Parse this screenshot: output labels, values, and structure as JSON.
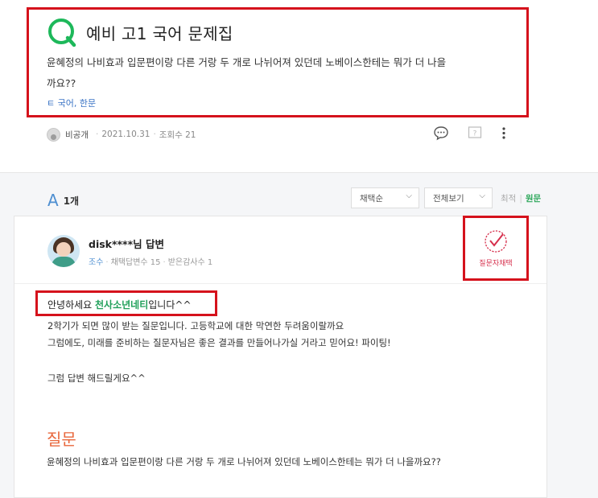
{
  "question": {
    "title": "예비 고1 국어 문제집",
    "body_line1": "윤혜정의 나비효과 입문편이랑 다른 거랑 두 개로 나뉘어져 있던데 노베이스한테는 뭐가 더 나을",
    "body_line2": "까요??",
    "tags": "ㅌ 국어, 한문",
    "author": "비공개",
    "date": "2021.10.31",
    "views": "조회수 21"
  },
  "answers": {
    "count_label": "1개",
    "sort_select": "채택순",
    "filter_select": "전체보기",
    "toggle_latest": "최적",
    "toggle_original": "원문"
  },
  "answer": {
    "name": "disk****님",
    "name_suffix": "답변",
    "grade": "조수",
    "adopted": "채택답변수 15",
    "thanks": "받은감사수 1",
    "adopt_label": "질문자채택",
    "hello_prefix": "안녕하세요 ",
    "hello_highlight": "천사소년네티",
    "hello_suffix": "입니다^^",
    "line1": "2학기가 되면 많이 받는 질문입니다. 고등학교에 대한 막연한 두려움이랄까요",
    "line2": "그럼에도, 미래를 준비하는 질문자님은 좋은 결과를 만들어나가실 거라고 믿어요! 파이팅!",
    "line3": "그럼 답변 해드릴게요^^",
    "question_heading": "질문",
    "question_repeat": "윤혜정의 나비효과 입문편이랑 다른 거랑 두 개로 나뉘어져 있던데 노베이스한테는 뭐가 더 나을까요??"
  },
  "colors": {
    "highlight_box": "#d5121c",
    "q_icon": "#1db85a",
    "answer_a": "#4e8fd1",
    "green_text": "#20a05a",
    "question_heading": "#e8673c"
  }
}
